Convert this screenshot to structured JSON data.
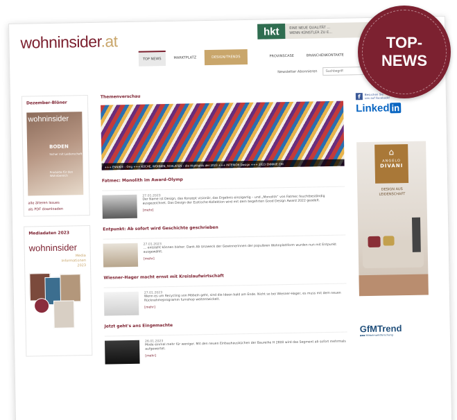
{
  "site": {
    "logo_main": "wohninsider",
    "logo_tld": ".at"
  },
  "top_banner": {
    "logo": "hkt",
    "text_line1": "EINE NEUE QUALITÄT …",
    "text_line2": "WENN KÜNSTLER ZU E…"
  },
  "nav": {
    "items": [
      {
        "label": "TOP NEWS"
      },
      {
        "label": "MARKTPLATZ"
      },
      {
        "label": "DESIGN/TRENDS"
      },
      {
        "label": "PROVINSCASE"
      },
      {
        "label": "BRANCHENKONTAKTE"
      }
    ]
  },
  "subnav": {
    "newsletter": "Newsletter Abonnieren",
    "search_placeholder": "Suchbegriff"
  },
  "left": {
    "december_title": "Dezember-Blöner",
    "cover_logo": "wohninsider",
    "cover_word": "BODEN",
    "cover_sub": "Sicher mit Leidenschaft",
    "cover_foot": "Produkte für den Wohnbereich",
    "link_issues": "alle älteren Issues",
    "link_pdf": "als PDF downloaden",
    "media_title": "Mediadaten 2023",
    "media_logo": "wohninsider",
    "media_sub1": "Media",
    "media_sub2": "Informationen",
    "media_sub3": "2023"
  },
  "center": {
    "section_title": "Themenverschau",
    "hero_caption": "+++ ENNIKIE – Orig +++ KÜCHE, WOHNEN, SCHLAFEN – die Highlights der 2023 +++ INTERIOR Design +++ 2023 ENNIKIE CHI",
    "articles": [
      {
        "title": "Fatmec: Monolith im Award-Olymp",
        "date": "27.01.2023",
        "text": "Der Name ist Design, das Konzept visionär, das Ergebnis einzigartig – und „Monolith“ von Fatmec feuchtbeständig ausgezeichnet. Das Design der Esstische-Kollektion wird mit dem begehrten Good Design Award 2022 geadelt.",
        "more": "[mehr]"
      },
      {
        "title": "Entpunkt: Ab sofort wird Geschichte geschrieben",
        "date": "27.01.2023",
        "text": "… entsteht können bisher: Dank Ab Unzweck der Gewinnerinnen der populären Wohnplattform wurden nun mit Entpunkt ausgewählt.",
        "more": "[mehr]"
      },
      {
        "title": "Wiesner-Hager macht ernst mit Kreislaufwirtschaft",
        "date": "27.01.2023",
        "text": "Wenn es um Recycling von Möbeln geht, sind die Ideen bald am Ende. Nicht so bei Wiesner-Hager, es muss mit dem neuen Rücknahmeprogramm furnshop weitentwickelt.",
        "more": "[mehr]"
      },
      {
        "title": "Jetzt geht's ans Eingemachte",
        "date": "26.01.2023",
        "text": "Mode einmal mehr für weniger. Mit den neuen Einbauhausküchen der Baureihe H 2800 wird das Segment ab sofort mehrmals aufgewertet.",
        "more": "[mehr]"
      }
    ]
  },
  "right": {
    "fb_line1": "Besuchen Sie",
    "fb_line2": "uns auf Facebook!",
    "linkedin_main": "Linked",
    "linkedin_in": "in",
    "ad_name1": "ANGELO",
    "ad_name2": "DIVANI",
    "ad_tag1": "DESIGN AUS",
    "ad_tag2": "LEIDENSCHAFT",
    "gfm_main": "GfMTrend",
    "gfm_sub": "▪▪▪ Möbelmarktforschung"
  },
  "badge": {
    "line1": "TOP-",
    "line2": "NEWS"
  },
  "colors": {
    "brand": "#7b1f2e",
    "gold": "#c9a66b",
    "badge": "#7c2130"
  }
}
